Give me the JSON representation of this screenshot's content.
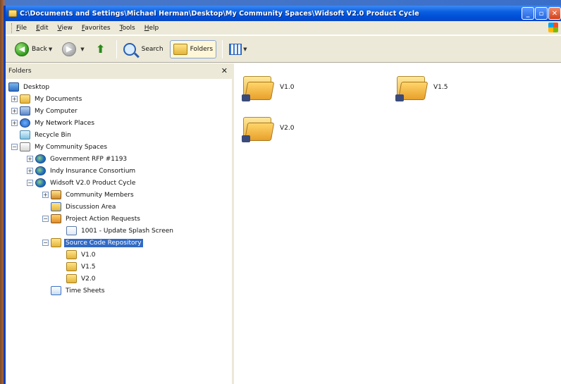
{
  "window": {
    "title": "C:\\Documents and Settings\\Michael Herman\\Desktop\\My Community Spaces\\Widsoft V2.0 Product Cycle"
  },
  "menubar": {
    "items": [
      "File",
      "Edit",
      "View",
      "Favorites",
      "Tools",
      "Help"
    ]
  },
  "toolbar": {
    "back_label": "Back",
    "search_label": "Search",
    "folders_label": "Folders"
  },
  "folders_pane": {
    "title": "Folders",
    "tree": [
      {
        "label": "Desktop",
        "icon": "desktop-icon"
      },
      {
        "label": "My Documents",
        "icon": "my-documents-icon",
        "expander": "+"
      },
      {
        "label": "My Computer",
        "icon": "my-computer-icon",
        "expander": "+"
      },
      {
        "label": "My Network Places",
        "icon": "network-places-icon",
        "expander": "+"
      },
      {
        "label": "Recycle Bin",
        "icon": "recycle-bin-icon"
      },
      {
        "label": "My Community Spaces",
        "icon": "community-spaces-icon",
        "expander": "−"
      },
      {
        "label": "Government RFP #1193",
        "icon": "globe-icon",
        "expander": "+"
      },
      {
        "label": "Indy Insurance Consortium",
        "icon": "globe-icon",
        "expander": "+"
      },
      {
        "label": "Widsoft V2.0 Product Cycle",
        "icon": "globe-icon",
        "expander": "−"
      },
      {
        "label": "Community Members",
        "icon": "members-icon",
        "expander": "+"
      },
      {
        "label": "Discussion Area",
        "icon": "discussion-icon"
      },
      {
        "label": "Project Action Requests",
        "icon": "action-requests-icon",
        "expander": "−"
      },
      {
        "label": "1001 - Update Splash Screen",
        "icon": "document-icon"
      },
      {
        "label": "Source Code Repository",
        "icon": "folder-icon",
        "expander": "−",
        "selected": true
      },
      {
        "label": "V1.0",
        "icon": "folder-icon"
      },
      {
        "label": "V1.5",
        "icon": "folder-icon"
      },
      {
        "label": "V2.0",
        "icon": "folder-icon"
      },
      {
        "label": "Time Sheets",
        "icon": "time-sheets-icon"
      }
    ]
  },
  "content": {
    "folders": [
      {
        "label": "V1.0"
      },
      {
        "label": "V1.5"
      },
      {
        "label": "V2.0"
      }
    ]
  },
  "colors": {
    "titlebar": "#0050d8",
    "selection": "#316ac5",
    "chrome": "#ece9d8"
  }
}
